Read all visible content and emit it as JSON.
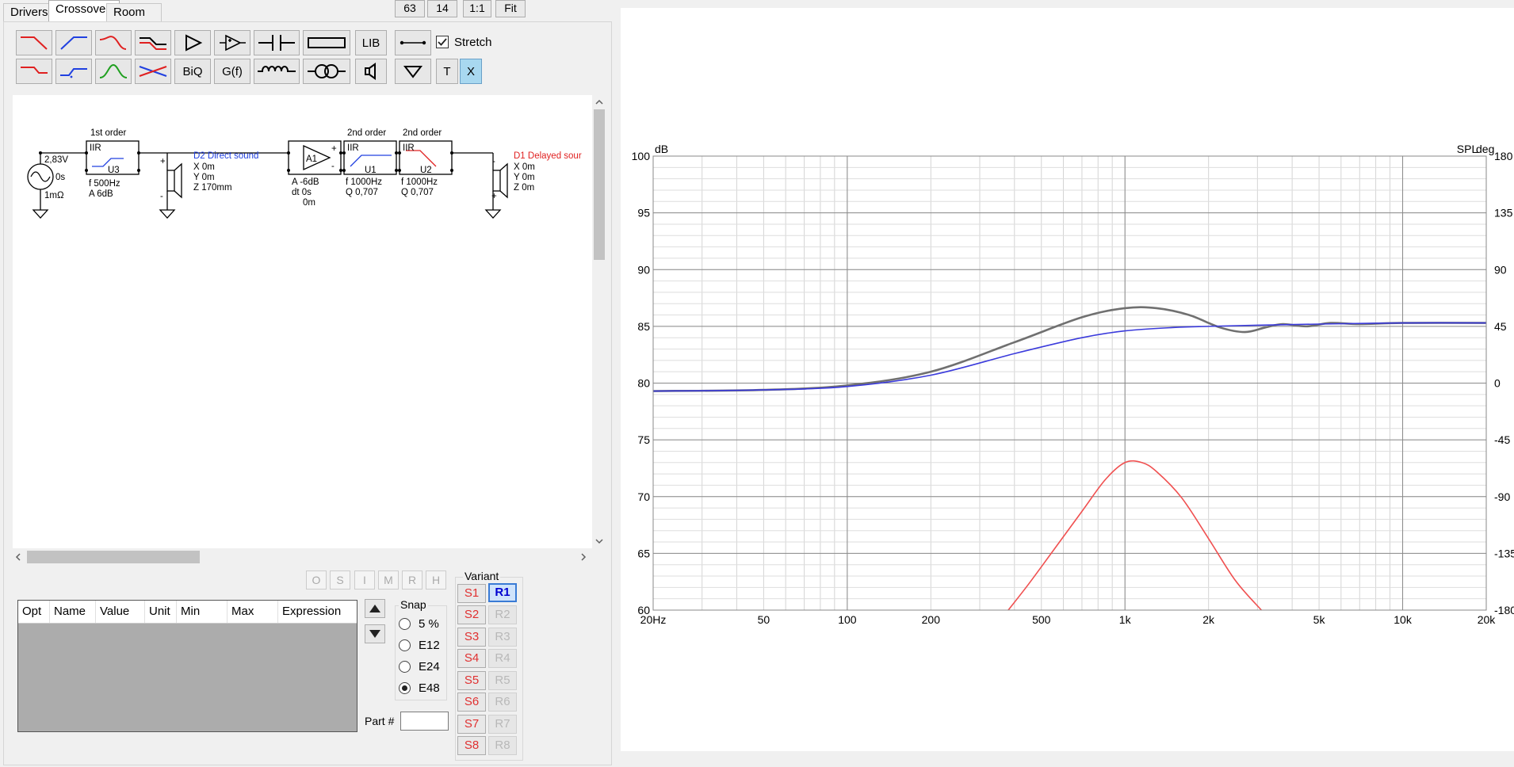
{
  "tabs": [
    "Drivers",
    "Crossover",
    "Room"
  ],
  "top_buttons": [
    "63",
    "14",
    "1:1",
    "Fit"
  ],
  "toolbar": {
    "bilinear_label": "BiQ",
    "gf_label": "G(f)",
    "lib_label": "LIB",
    "stretch_label": "Stretch",
    "stretch_checked": true,
    "t_label": "T",
    "x_label": "X"
  },
  "schematic": {
    "source": {
      "voltage": "2,83V",
      "delay": "0s",
      "impedance": "1mΩ"
    },
    "u3": {
      "title": "1st order",
      "type": "IIR",
      "name": "U3",
      "f": "f   500Hz",
      "a": "A  6dB"
    },
    "d2": {
      "name": "D2 Direct sound",
      "x": "X 0m",
      "y": "Y 0m",
      "z": "Z 170mm"
    },
    "a1": {
      "name": "A1",
      "a": "A -6dB",
      "dt": "dt 0s",
      "dist": "0m"
    },
    "u1": {
      "title": "2nd order",
      "type": "IIR",
      "name": "U1",
      "f": "f   1000Hz",
      "q": "Q  0,707"
    },
    "u2": {
      "title": "2nd order",
      "type": "IIR",
      "name": "U2",
      "f": "f   1000Hz",
      "q": "Q  0,707"
    },
    "d1": {
      "name": "D1 Delayed sour",
      "x": "X 0m",
      "y": "Y 0m",
      "z": "Z 0m"
    }
  },
  "opt_buttons": [
    "O",
    "S",
    "I",
    "M",
    "R",
    "H"
  ],
  "grid_columns": [
    "Opt",
    "Name",
    "Value",
    "Unit",
    "Min",
    "Max",
    "Expression"
  ],
  "snap": {
    "label": "Snap",
    "options": [
      "5 %",
      "E12",
      "E24",
      "E48"
    ],
    "selected": "E48"
  },
  "part_label": "Part #",
  "variant": {
    "label": "Variant",
    "s_buttons": [
      "S1",
      "S2",
      "S3",
      "S4",
      "S5",
      "S6",
      "S7",
      "S8"
    ],
    "r_buttons": [
      "R1",
      "R2",
      "R3",
      "R4",
      "R5",
      "R6",
      "R7",
      "R8"
    ],
    "active": "R1"
  },
  "chart_data": {
    "type": "line",
    "title": "SPL",
    "ylabel": "dB",
    "y2label": "deg",
    "xscale": "log",
    "xlim": [
      20,
      20000
    ],
    "ylim": [
      60,
      100
    ],
    "y2lim": [
      -180,
      180
    ],
    "x_ticks": [
      "20Hz",
      "50",
      "100",
      "200",
      "500",
      "1k",
      "2k",
      "5k",
      "10k",
      "20k"
    ],
    "y_ticks": [
      "100",
      "95",
      "90",
      "85",
      "80",
      "75",
      "70",
      "65",
      "60"
    ],
    "y2_ticks": [
      "180",
      "135",
      "90",
      "45",
      "0",
      "-45",
      "-90",
      "-135",
      "-180"
    ],
    "grid": true,
    "series": [
      {
        "color": "#707070",
        "x": [
          20,
          50,
          100,
          200,
          400,
          700,
          1000,
          1300,
          1700,
          2200,
          2700,
          3200,
          3700,
          4500,
          5500,
          7000,
          10000,
          20000
        ],
        "y": [
          79.3,
          79.4,
          79.8,
          81.0,
          83.6,
          85.8,
          86.6,
          86.6,
          86.0,
          84.9,
          84.5,
          84.9,
          85.2,
          85.0,
          85.3,
          85.2,
          85.3,
          85.3
        ]
      },
      {
        "color": "#3b3bdc",
        "x": [
          20,
          50,
          100,
          200,
          400,
          700,
          1000,
          1500,
          2000,
          3000,
          5000,
          10000,
          20000
        ],
        "y": [
          79.3,
          79.4,
          79.7,
          80.7,
          82.6,
          84.0,
          84.6,
          84.9,
          85.0,
          85.1,
          85.2,
          85.3,
          85.3
        ]
      },
      {
        "color": "#f05050",
        "x": [
          380,
          450,
          550,
          700,
          850,
          1000,
          1150,
          1300,
          1600,
          2000,
          2500,
          3100
        ],
        "y": [
          60.0,
          62.3,
          65.2,
          68.7,
          71.5,
          73.0,
          73.0,
          72.2,
          69.9,
          66.3,
          62.6,
          60.0
        ]
      }
    ]
  }
}
